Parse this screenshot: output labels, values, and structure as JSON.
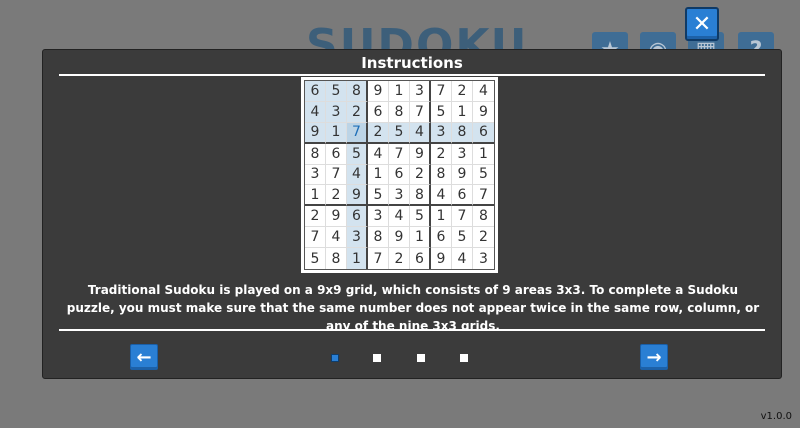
{
  "background": {
    "title": "SUDOKU",
    "buttons": [
      {
        "name": "star-icon",
        "glyph": "★"
      },
      {
        "name": "eye-icon",
        "glyph": "◉"
      },
      {
        "name": "grid-icon",
        "glyph": "▦"
      },
      {
        "name": "help-icon",
        "glyph": "?"
      }
    ],
    "version": "v1.0.0"
  },
  "modal": {
    "title": "Instructions",
    "description": "Traditional Sudoku is played on a 9x9 grid, which consists of 9 areas 3x3. To complete a Sudoku puzzle, you must make sure that the same number does not appear twice in the same row, column, or any of the nine 3x3 grids.",
    "prev_icon": "←",
    "next_icon": "→",
    "close_icon": "✕",
    "pages": 4,
    "current_page": 1
  },
  "board": {
    "rows": [
      [
        "6",
        "5",
        "8",
        "9",
        "1",
        "3",
        "7",
        "2",
        "4"
      ],
      [
        "4",
        "3",
        "2",
        "6",
        "8",
        "7",
        "5",
        "1",
        "9"
      ],
      [
        "9",
        "1",
        "7",
        "2",
        "5",
        "4",
        "3",
        "8",
        "6"
      ],
      [
        "8",
        "6",
        "5",
        "4",
        "7",
        "9",
        "2",
        "3",
        "1"
      ],
      [
        "3",
        "7",
        "4",
        "1",
        "6",
        "2",
        "8",
        "9",
        "5"
      ],
      [
        "1",
        "2",
        "9",
        "5",
        "3",
        "8",
        "4",
        "6",
        "7"
      ],
      [
        "2",
        "9",
        "6",
        "3",
        "4",
        "5",
        "1",
        "7",
        "8"
      ],
      [
        "7",
        "4",
        "3",
        "8",
        "9",
        "1",
        "6",
        "5",
        "2"
      ],
      [
        "5",
        "8",
        "1",
        "7",
        "2",
        "6",
        "9",
        "4",
        "3"
      ]
    ],
    "selected": {
      "row": 3,
      "col": 3
    },
    "colors": {
      "highlight": "#d3e3ef",
      "selected_text": "#1e6fb8",
      "accent": "#2a7fd4"
    }
  }
}
